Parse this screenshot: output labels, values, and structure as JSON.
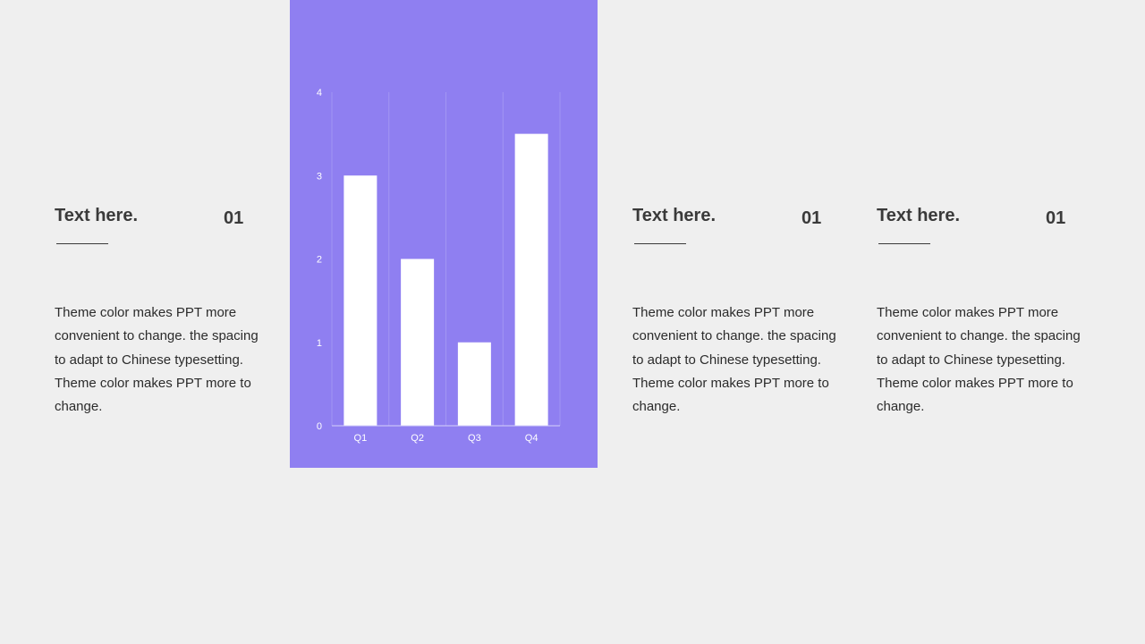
{
  "cards": [
    {
      "title": "Text here.",
      "number": "01",
      "body": "Theme  color makes PPT more convenient to change. the spacing to adapt to Chinese typesetting. Theme  color makes PPT more to change."
    },
    {
      "title": "Text here.",
      "number": "01",
      "body": "Theme  color makes PPT more convenient to change. the spacing to adapt to Chinese typesetting. Theme  color makes PPT more to change."
    },
    {
      "title": "Text here.",
      "number": "01",
      "body": "Theme  color makes PPT more convenient to change. the spacing to adapt to Chinese typesetting. Theme  color makes PPT more to change."
    }
  ],
  "colors": {
    "panel": "#8f7ff1",
    "bar": "#ffffff",
    "background": "#efefef",
    "text": "#3a3a3a"
  },
  "chart_data": {
    "type": "bar",
    "categories": [
      "Q1",
      "Q2",
      "Q3",
      "Q4"
    ],
    "values": [
      3,
      2,
      1,
      3.5
    ],
    "ylim": [
      0,
      4
    ],
    "yticks": [
      "0",
      "1",
      "2",
      "3",
      "4"
    ],
    "grid": "vertical",
    "legend": "none"
  }
}
